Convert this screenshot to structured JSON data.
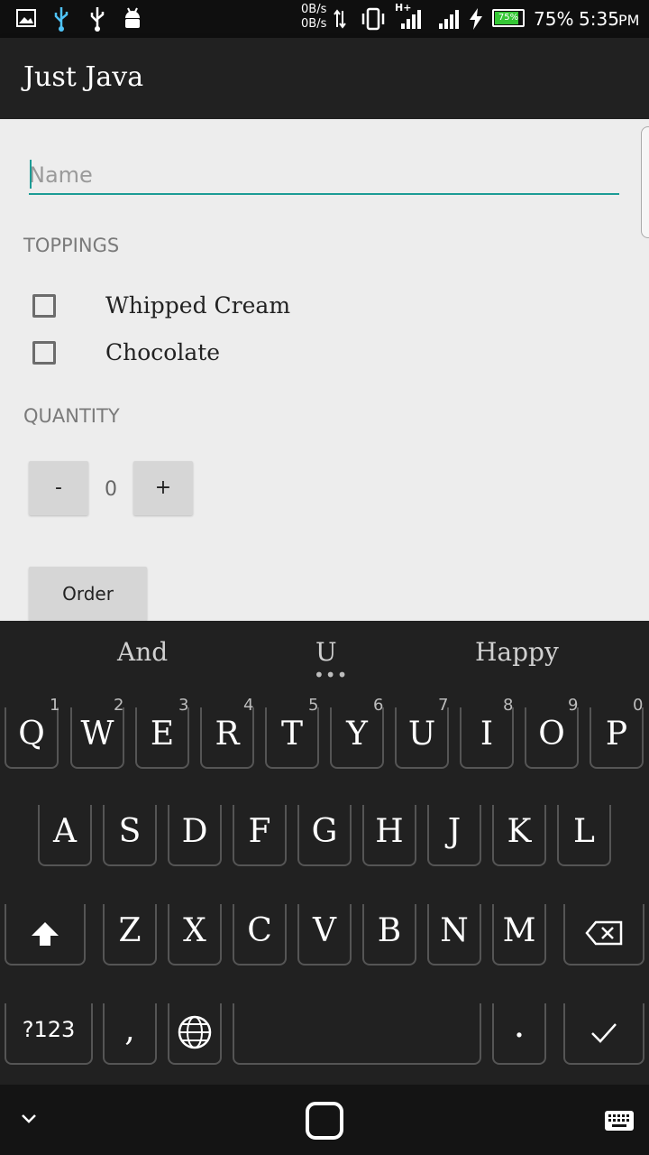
{
  "status_bar": {
    "net_up": "0B/s",
    "net_down": "0B/s",
    "network_type": "H+",
    "battery_icon_text": "75%",
    "battery_percent": "75%",
    "time": "5:35",
    "ampm": "PM",
    "battery_color": "#35c735"
  },
  "app_bar": {
    "title": "Just Java"
  },
  "form": {
    "name_placeholder": "Name",
    "toppings_header": "TOPPINGS",
    "toppings": [
      {
        "label": "Whipped Cream",
        "checked": false
      },
      {
        "label": "Chocolate",
        "checked": false
      }
    ],
    "quantity_header": "QUANTITY",
    "decrement_label": "-",
    "increment_label": "+",
    "quantity_value": "0",
    "order_label": "Order",
    "accent_color": "#1c9c96"
  },
  "keyboard": {
    "suggestions": [
      "And",
      "U",
      "Happy"
    ],
    "row1": [
      "Q",
      "W",
      "E",
      "R",
      "T",
      "Y",
      "U",
      "I",
      "O",
      "P"
    ],
    "row1_hints": [
      "1",
      "2",
      "3",
      "4",
      "5",
      "6",
      "7",
      "8",
      "9",
      "0"
    ],
    "row2": [
      "A",
      "S",
      "D",
      "F",
      "G",
      "H",
      "J",
      "K",
      "L"
    ],
    "row3": [
      "Z",
      "X",
      "C",
      "V",
      "B",
      "N",
      "M"
    ],
    "symbols_key": "?123",
    "comma_key": ",",
    "period_key": "."
  }
}
